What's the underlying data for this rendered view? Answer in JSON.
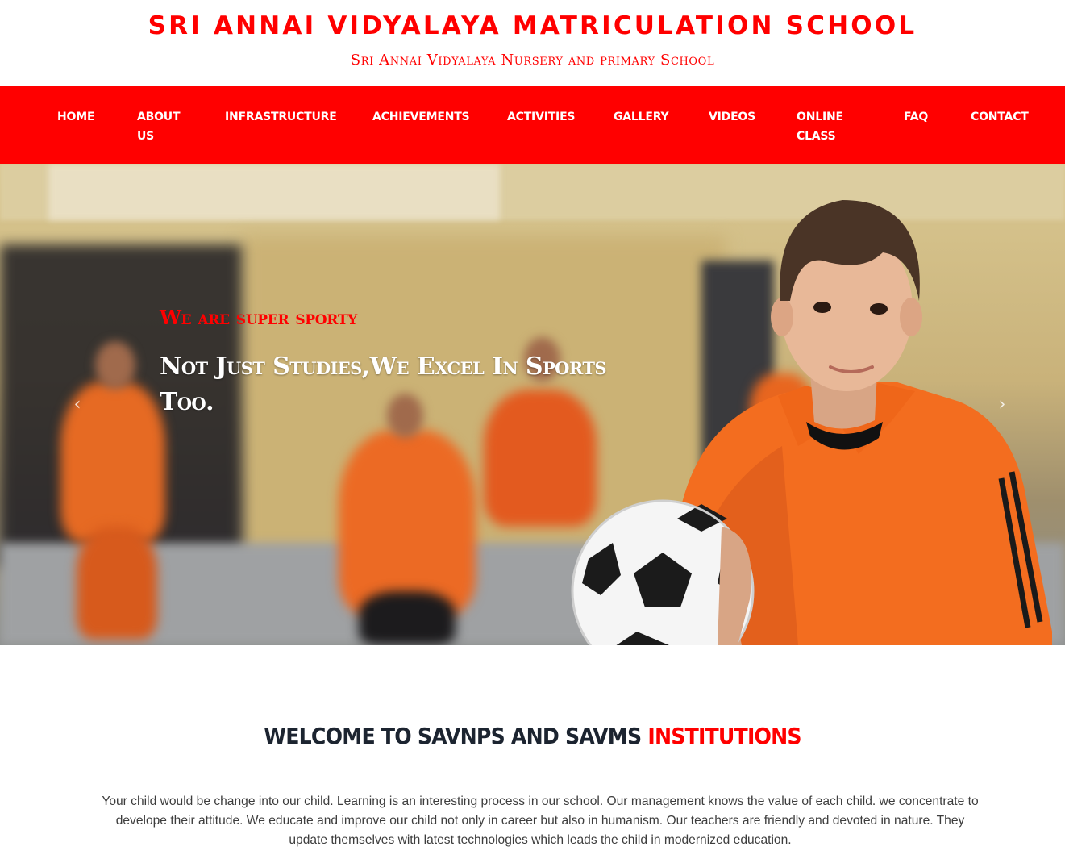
{
  "header": {
    "title": "SRI ANNAI VIDYALAYA MATRICULATION SCHOOL",
    "subtitle": "Sri Annai Vidyalaya Nursery and primary School"
  },
  "nav": {
    "items": [
      {
        "label": "HOME"
      },
      {
        "label": "ABOUT US"
      },
      {
        "label": "INFRASTRUCTURE"
      },
      {
        "label": "ACHIEVEMENTS"
      },
      {
        "label": "ACTIVITIES"
      },
      {
        "label": "GALLERY"
      },
      {
        "label": "VIDEOS"
      },
      {
        "label": "ONLINE CLASS"
      },
      {
        "label": "FAQ"
      },
      {
        "label": "CONTACT"
      }
    ]
  },
  "hero": {
    "kicker": "We are super sporty",
    "heading": "Not Just Studies,We Excel In Sports Too.",
    "prev_icon": "chevron-left-icon",
    "next_icon": "chevron-right-icon"
  },
  "welcome": {
    "heading_main": "WELCOME TO SAVNPS AND SAVMS",
    "heading_accent": "INSTITUTIONS",
    "body": "Your child would be change into our child. Learning is an interesting process in our school. Our management knows the value of each child. we concentrate to develope their attitude. We educate and improve our child not only in career but also in humanism. Our teachers are friendly and devoted in nature. They update themselves with latest technologies which leads the child in modernized education."
  },
  "colors": {
    "brand_red": "#ff0000",
    "heading_dark": "#1c2430",
    "nav_text": "#ffffff"
  }
}
